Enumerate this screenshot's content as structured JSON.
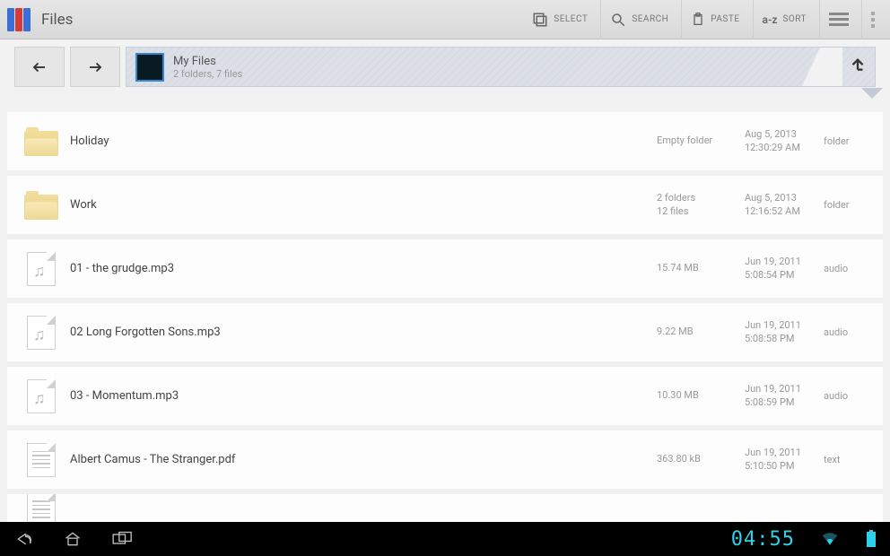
{
  "app": {
    "title": "Files"
  },
  "toolbar": {
    "select": "SELECT",
    "search": "SEARCH",
    "paste": "PASTE",
    "sort": "SORT"
  },
  "breadcrumb": {
    "title": "My Files",
    "subtitle": "2 folders, 7 files"
  },
  "files": [
    {
      "icon": "folder",
      "name": "Holiday",
      "size": "Empty folder",
      "date": "Aug 5, 2013",
      "time": "12:30:29 AM",
      "type": "folder"
    },
    {
      "icon": "folder",
      "name": "Work",
      "size": "2 folders\n12 files",
      "date": "Aug 5, 2013",
      "time": "12:16:52 AM",
      "type": "folder"
    },
    {
      "icon": "audio",
      "name": "01 - the grudge.mp3",
      "size": "15.74 MB",
      "date": "Jun 19, 2011",
      "time": "5:08:54 PM",
      "type": "audio"
    },
    {
      "icon": "audio",
      "name": "02 Long Forgotten Sons.mp3",
      "size": "9.22 MB",
      "date": "Jun 19, 2011",
      "time": "5:08:58 PM",
      "type": "audio"
    },
    {
      "icon": "audio",
      "name": "03 - Momentum.mp3",
      "size": "10.30 MB",
      "date": "Jun 19, 2011",
      "time": "5:08:59 PM",
      "type": "audio"
    },
    {
      "icon": "text",
      "name": "Albert Camus - The Stranger.pdf",
      "size": "363.80 kB",
      "date": "Jun 19, 2011",
      "time": "5:10:50 PM",
      "type": "text"
    },
    {
      "icon": "text",
      "name": "",
      "size": "",
      "date": "",
      "time": "",
      "type": ""
    }
  ],
  "system": {
    "clock": "04:55"
  }
}
